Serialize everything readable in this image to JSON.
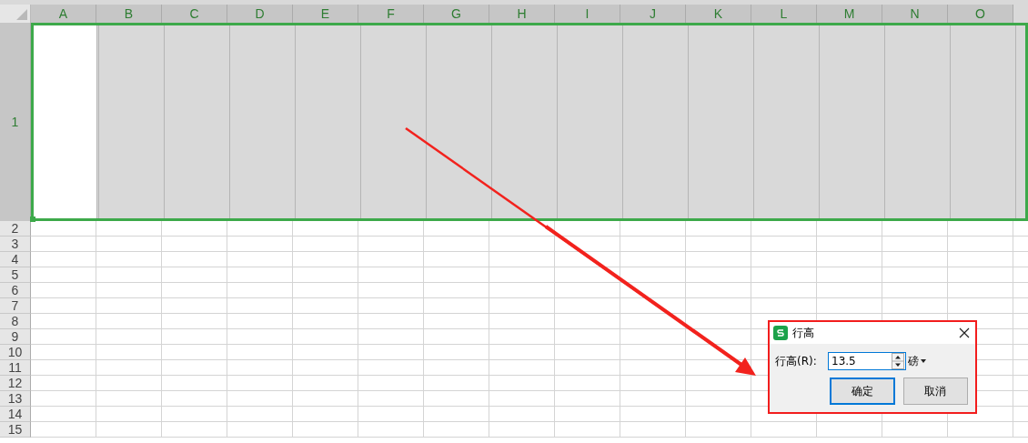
{
  "columns": [
    {
      "label": "A"
    },
    {
      "label": "B"
    },
    {
      "label": "C"
    },
    {
      "label": "D"
    },
    {
      "label": "E"
    },
    {
      "label": "F"
    },
    {
      "label": "G"
    },
    {
      "label": "H"
    },
    {
      "label": "I"
    },
    {
      "label": "J"
    },
    {
      "label": "K"
    },
    {
      "label": "L"
    },
    {
      "label": "M"
    },
    {
      "label": "N"
    },
    {
      "label": "O"
    }
  ],
  "rows": [
    {
      "label": "1",
      "selected": true
    },
    {
      "label": "2",
      "selected": false
    },
    {
      "label": "3",
      "selected": false
    },
    {
      "label": "4",
      "selected": false
    },
    {
      "label": "5",
      "selected": false
    },
    {
      "label": "6",
      "selected": false
    },
    {
      "label": "7",
      "selected": false
    },
    {
      "label": "8",
      "selected": false
    },
    {
      "label": "9",
      "selected": false
    },
    {
      "label": "10",
      "selected": false
    },
    {
      "label": "11",
      "selected": false
    },
    {
      "label": "12",
      "selected": false
    },
    {
      "label": "13",
      "selected": false
    },
    {
      "label": "14",
      "selected": false
    },
    {
      "label": "15",
      "selected": false
    }
  ],
  "dialog": {
    "title": "行高",
    "field_label": "行高(R):",
    "value": "13.5",
    "unit": "磅",
    "buttons": [
      {
        "label": "确定",
        "default": true
      },
      {
        "label": "取消",
        "default": false
      }
    ]
  }
}
